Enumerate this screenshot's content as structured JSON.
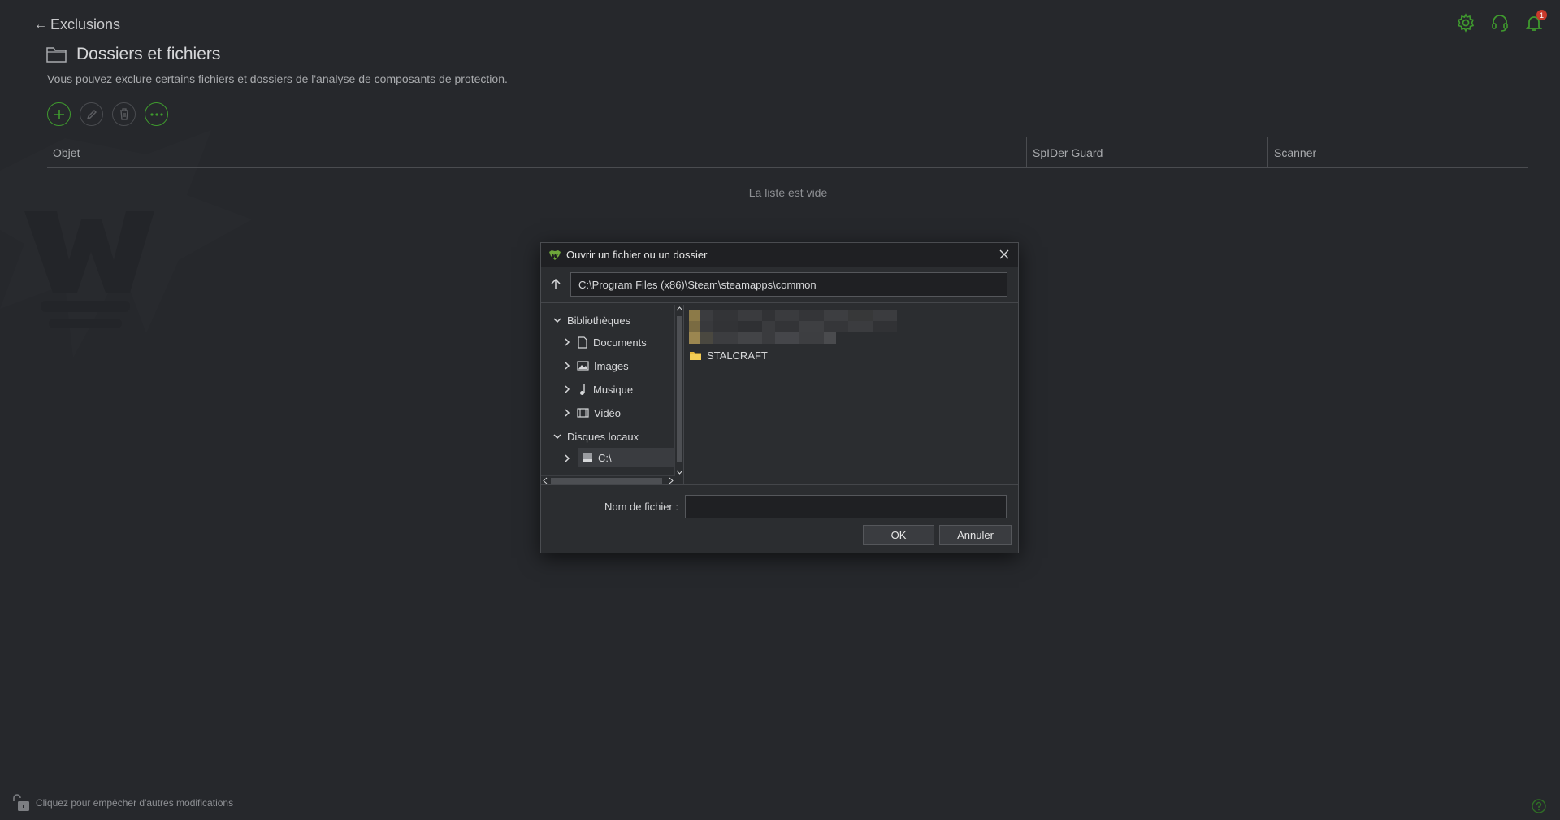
{
  "header": {
    "back_label": "Exclusions",
    "title": "Dossiers et fichiers",
    "subtitle": "Vous pouvez exclure certains fichiers et dossiers de l'analyse de composants de protection.",
    "notification_count": "1"
  },
  "toolbar": {
    "buttons": [
      "add-icon",
      "edit-icon",
      "delete-icon",
      "more-icon"
    ]
  },
  "table": {
    "columns": [
      "Objet",
      "SpIDer Guard",
      "Scanner"
    ],
    "empty_text": "La liste est vide"
  },
  "footer": {
    "lock_text": "Cliquez pour empêcher d'autres modifications"
  },
  "dialog": {
    "title": "Ouvrir un fichier ou un dossier",
    "path": "C:\\Program Files (x86)\\Steam\\steamapps\\common",
    "tree": [
      {
        "label": "Bibliothèques",
        "icon": "chevron-down-icon"
      },
      {
        "label": "Documents",
        "icon": "document-icon"
      },
      {
        "label": "Images",
        "icon": "image-icon"
      },
      {
        "label": "Musique",
        "icon": "music-icon"
      },
      {
        "label": "Vidéo",
        "icon": "video-icon"
      },
      {
        "label": "Disques locaux",
        "icon": "chevron-down-icon"
      },
      {
        "label": "C:\\",
        "icon": "drive-icon"
      }
    ],
    "files": [
      "STALCRAFT"
    ],
    "filename_label": "Nom de fichier :",
    "filename_value": "",
    "ok_label": "OK",
    "cancel_label": "Annuler"
  },
  "colors": {
    "background": "#26282c",
    "accent_green": "#3f9a2e",
    "badge_red": "#c93a2c",
    "folder_yellow": "#e8b93c"
  }
}
